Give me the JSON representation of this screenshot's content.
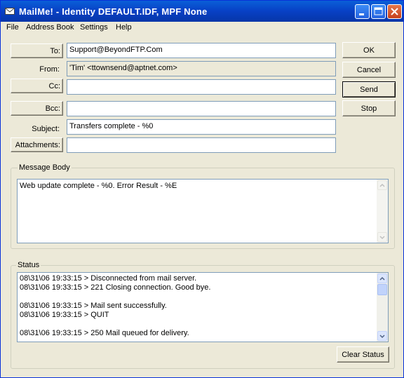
{
  "window": {
    "title": "MailMe! - Identity DEFAULT.IDF, MPF None"
  },
  "menu": [
    "File",
    "Address Book",
    "Settings",
    "Help"
  ],
  "form": {
    "to_label": "To:",
    "to_value": "Support@BeyondFTP.Com",
    "from_label": "From:",
    "from_value": "'Tim' <ttownsend@aptnet.com>",
    "cc_label": "Cc:",
    "cc_value": "",
    "bcc_label": "Bcc:",
    "bcc_value": "",
    "subject_label": "Subject:",
    "subject_value": "Transfers complete - %0",
    "attachments_label": "Attachments:",
    "attachments_value": ""
  },
  "actions": {
    "ok": "OK",
    "cancel": "Cancel",
    "send": "Send",
    "stop": "Stop"
  },
  "message": {
    "group_label": "Message Body",
    "text": "Web update complete - %0.  Error Result - %E"
  },
  "status": {
    "group_label": "Status",
    "lines": [
      "08\\31\\06 19:33:15 > Disconnected from mail server.",
      "08\\31\\06 19:33:15 > 221 Closing connection. Good bye.",
      "",
      "08\\31\\06 19:33:15 > Mail sent successfully.",
      "08\\31\\06 19:33:15 > QUIT",
      "",
      "08\\31\\06 19:33:15 > 250 Mail queued for delivery."
    ],
    "clear_label": "Clear Status"
  },
  "colors": {
    "titlebar": "#0a5fd8",
    "face": "#ece9d8",
    "field_border": "#7f9db9"
  }
}
